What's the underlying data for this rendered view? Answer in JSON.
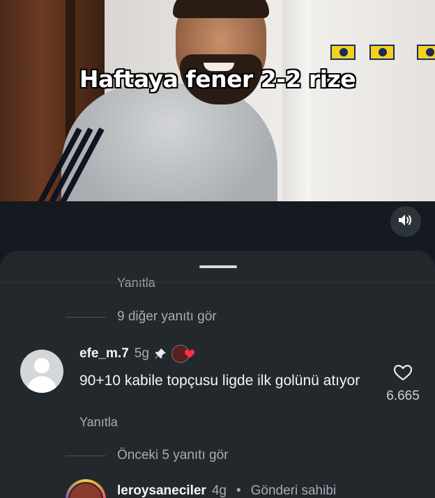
{
  "video": {
    "caption": "Haftaya fener 2-2 rize"
  },
  "controls": {
    "mute_icon": "speaker-icon"
  },
  "comments_sheet": {
    "cutoff_label": "Yanıtla",
    "view_more_replies": "9 diğer yanıtı gör",
    "comment": {
      "username": "efe_m.7",
      "time": "5g",
      "pinned_icon": "pin-icon",
      "text": "90+10 kabile topçusu ligde ilk golünü atıyor",
      "reply_label": "Yanıtla",
      "like_count": "6.665",
      "liked_by_author": true
    },
    "view_previous_replies": "Önceki 5 yanıtı gör",
    "reply": {
      "username": "leroysaneciler",
      "time": "4g",
      "separator": "•",
      "author_badge": "Gönderi sahibi"
    }
  },
  "colors": {
    "background": "#141a1f",
    "sheet": "#23282d",
    "like_heart": "#ff3040",
    "flag_yellow": "#f3d21e",
    "flag_navy": "#1c2a5a"
  }
}
